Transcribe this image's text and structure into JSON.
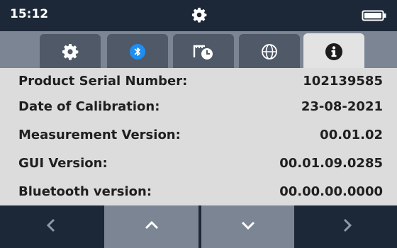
{
  "status": {
    "time": "15:12",
    "center_icon": "gear-icon",
    "battery_icon": "battery-icon"
  },
  "tabs": [
    {
      "icon": "gear-icon",
      "active": false
    },
    {
      "icon": "bluetooth-icon",
      "active": false
    },
    {
      "icon": "calibration-clock-icon",
      "active": false
    },
    {
      "icon": "globe-icon",
      "active": false
    },
    {
      "icon": "info-icon",
      "active": true
    }
  ],
  "info": {
    "rows": [
      {
        "label": "Product Serial Number:",
        "value": "102139585"
      },
      {
        "label": "Date of Calibration:",
        "value": "23-08-2021"
      },
      {
        "label": "Measurement Version:",
        "value": "00.01.02"
      },
      {
        "label": "GUI Version:",
        "value": "00.01.09.0285"
      },
      {
        "label": "Bluetooth version:",
        "value": "00.00.00.0000"
      }
    ]
  },
  "nav": [
    {
      "icon": "chevron-left-icon"
    },
    {
      "icon": "chevron-up-icon"
    },
    {
      "icon": "chevron-down-icon"
    },
    {
      "icon": "chevron-right-icon"
    }
  ],
  "colors": {
    "dark_bg": "#1c2737",
    "tab_strip": "#7b8593",
    "tab_inactive": "#4f5968",
    "tab_active": "#e3e3e3",
    "panel_bg": "#dcdcdc",
    "bluetooth_blue": "#1f8ef1"
  }
}
